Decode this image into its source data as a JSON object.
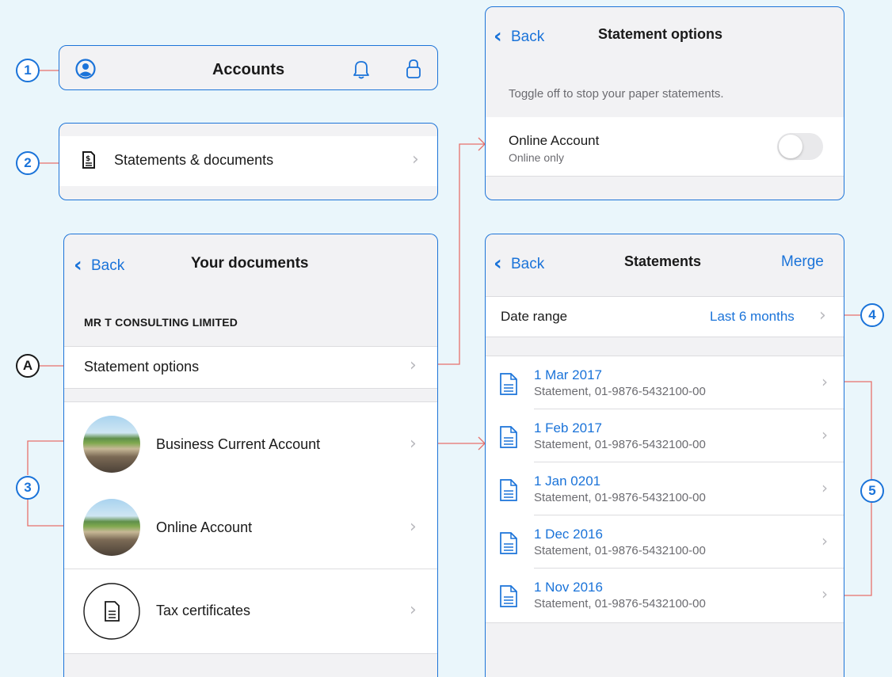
{
  "badges": {
    "b1": "1",
    "b2": "2",
    "b3": "3",
    "b4": "4",
    "b5": "5",
    "bA": "A"
  },
  "header_bar": {
    "title": "Accounts",
    "profile_icon": "profile-icon",
    "bell_icon": "bell-icon",
    "lock_icon": "lock-icon"
  },
  "statements_entry": {
    "label": "Statements & documents",
    "icon": "document-icon"
  },
  "your_documents": {
    "back": "Back",
    "title": "Your documents",
    "section": "MR T CONSULTING LIMITED",
    "statement_options": "Statement options",
    "accounts": [
      {
        "name": "Business Current Account"
      },
      {
        "name": "Online Account"
      }
    ],
    "tax": "Tax certificates"
  },
  "statement_options": {
    "back": "Back",
    "title": "Statement options",
    "hint": "Toggle off to stop your paper statements.",
    "account_name": "Online Account",
    "account_sub": "Online only",
    "toggle_on": false
  },
  "statements": {
    "back": "Back",
    "title": "Statements",
    "merge": "Merge",
    "date_range_label": "Date range",
    "date_range_value": "Last 6 months",
    "items": [
      {
        "date": "1 Mar 2017",
        "desc": "Statement, 01-9876-5432100-00"
      },
      {
        "date": "1 Feb 2017",
        "desc": "Statement, 01-9876-5432100-00"
      },
      {
        "date": "1 Jan 0201",
        "desc": "Statement, 01-9876-5432100-00"
      },
      {
        "date": "1 Dec 2016",
        "desc": "Statement, 01-9876-5432100-00"
      },
      {
        "date": "1 Nov 2016",
        "desc": "Statement, 01-9876-5432100-00"
      }
    ]
  },
  "colors": {
    "accent": "#1a73d9",
    "connector": "#e8716b",
    "background": "#eaf6fb"
  }
}
